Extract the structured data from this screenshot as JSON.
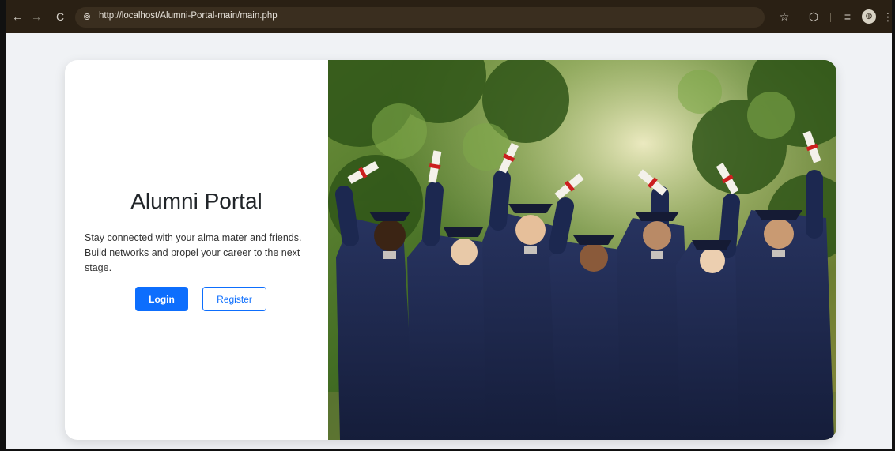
{
  "browser": {
    "url": "http://localhost/Alumni-Portal-main/main.php",
    "icons": {
      "back": "←",
      "forward": "→",
      "reload": "C",
      "site_info": "⦾",
      "bookmark": "☆",
      "extensions": "⬡",
      "tab_search": "≡",
      "profile": "◍",
      "menu": "⋮"
    }
  },
  "page": {
    "title": "Alumni Portal",
    "tagline": "Stay connected with your alma mater and friends. Build networks and propel your career to the next stage.",
    "login_label": "Login",
    "register_label": "Register"
  },
  "colors": {
    "primary": "#0d6efd",
    "page_bg": "#f0f2f5",
    "gown": "#1c2850",
    "foliage": "#4f7a2c"
  }
}
